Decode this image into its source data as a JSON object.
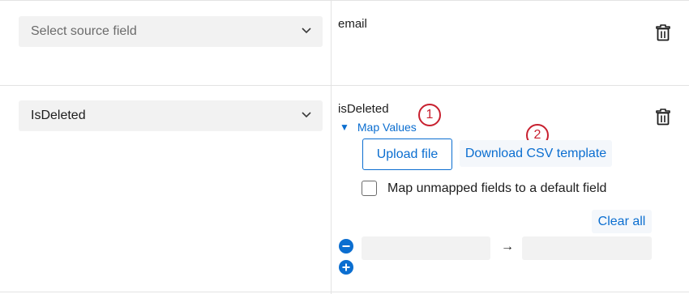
{
  "rows": [
    {
      "select_placeholder": "Select source field",
      "field_name": "email",
      "chevron_icon": "chevron-down-icon",
      "delete_icon": "trash-icon"
    },
    {
      "select_value": "IsDeleted",
      "field_name": "isDeleted",
      "chevron_icon": "chevron-down-icon",
      "delete_icon": "trash-icon",
      "map_values": {
        "toggle_label": "Map Values",
        "toggle_icon": "triangle-down-icon",
        "upload_label": "Upload file",
        "download_label": "Download CSV template",
        "checkbox_label": "Map unmapped fields to a default field",
        "checkbox_checked": false,
        "clear_all_label": "Clear all",
        "mapping_row": {
          "source_value": "",
          "target_value": "",
          "arrow": "→",
          "remove_icon": "minus-circle-icon",
          "add_icon": "plus-circle-icon"
        }
      }
    }
  ],
  "annotations": {
    "marker_1": "1",
    "marker_2": "2",
    "color": "#c8202f"
  },
  "colors": {
    "accent": "#0b6ed0",
    "field_bg": "#f2f2f2",
    "divider": "#e3e3e3"
  }
}
